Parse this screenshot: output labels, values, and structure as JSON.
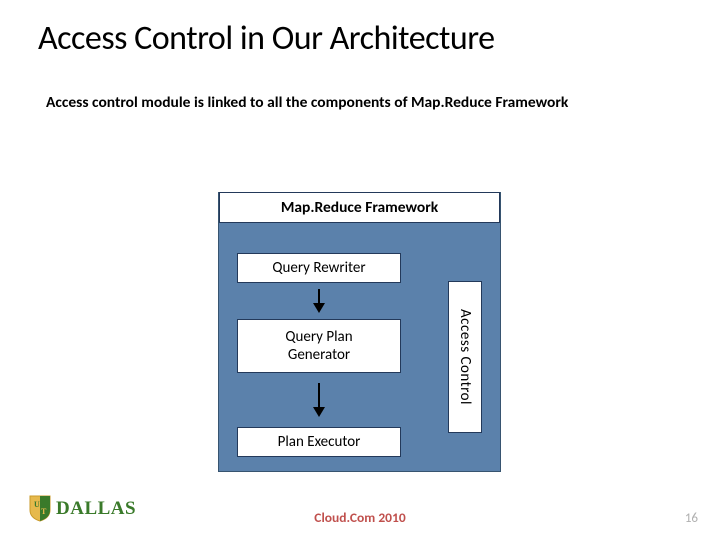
{
  "title": "Access Control in Our Architecture",
  "subtitle": "Access control module is linked to all the components of Map.Reduce Framework",
  "diagram": {
    "framework_label": "Map.Reduce Framework",
    "boxes": [
      "Query Rewriter",
      "Query Plan\nGenerator",
      "Plan Executor"
    ],
    "access_control": "Access Control"
  },
  "footer": {
    "logo_text": "DALLAS",
    "event": "Cloud.Com 2010",
    "page": "16"
  },
  "colors": {
    "diagram_bg": "#5b81ab",
    "box_border": "#23395a",
    "footer_accent": "#c0504d",
    "logo_green": "#3a7a2a",
    "logo_gold": "#e6b94c"
  }
}
